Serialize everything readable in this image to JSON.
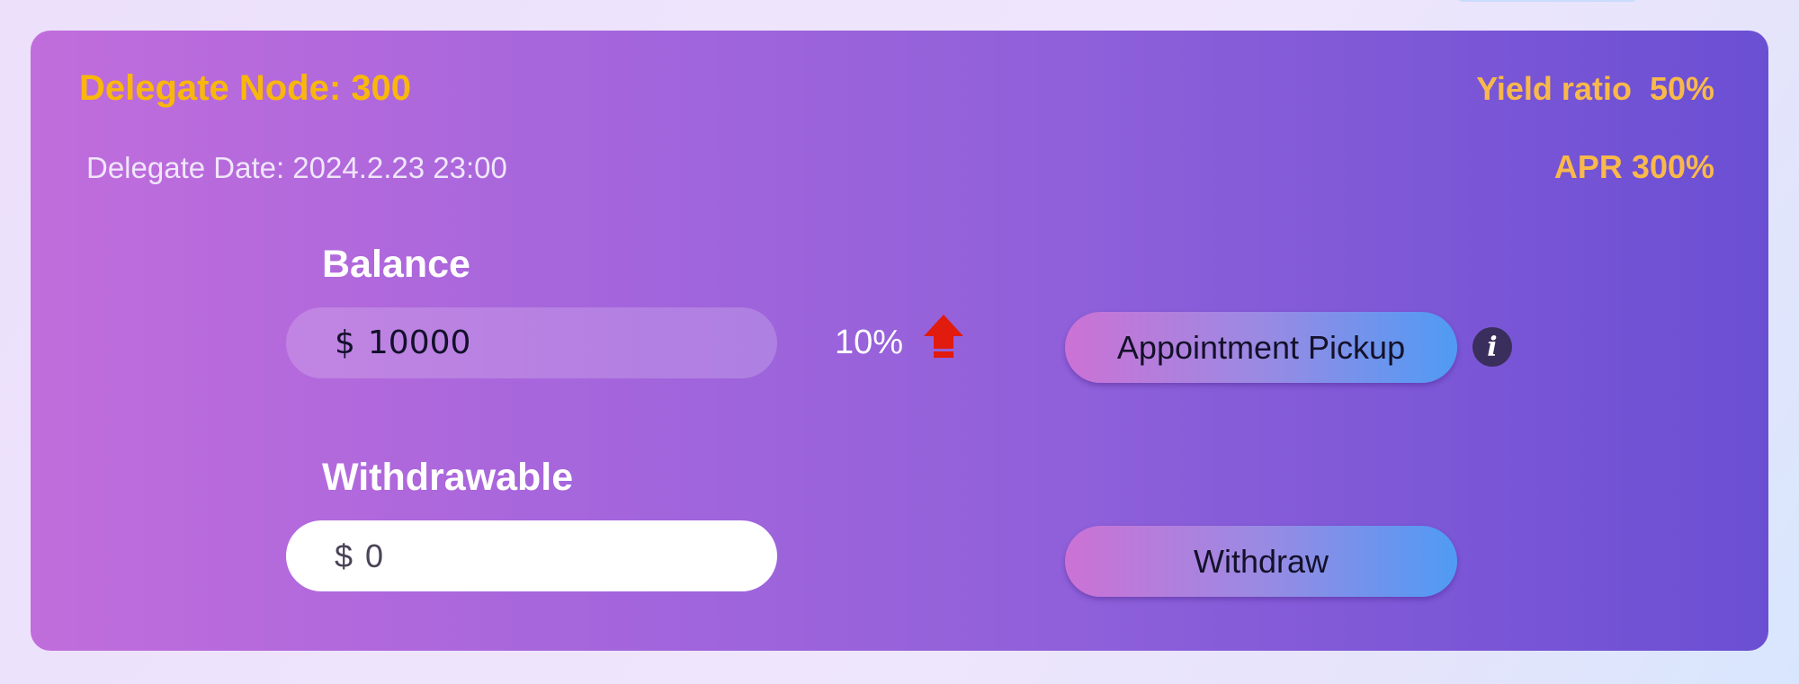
{
  "node": {
    "title": "Delegate Node: 300",
    "date": "Delegate Date: 2024.2.23 23:00",
    "yield_ratio": "Yield ratio  50%",
    "apr": "APR 300%"
  },
  "balance": {
    "label": "Balance",
    "currency": "$",
    "value": "10000",
    "change": "10%",
    "change_icon": "red-up-arrow-icon"
  },
  "withdrawable": {
    "label": "Withdrawable",
    "currency": "$",
    "value": "0"
  },
  "actions": {
    "pickup_label": "Appointment Pickup",
    "withdraw_label": "Withdraw",
    "info_icon": "info-icon",
    "info_symbol": "i"
  },
  "colors": {
    "accent_yellow": "#f9b70b",
    "stat_orange": "#f9b94a",
    "up_arrow": "#e11b0e",
    "info_bg": "#3a2e5c"
  }
}
